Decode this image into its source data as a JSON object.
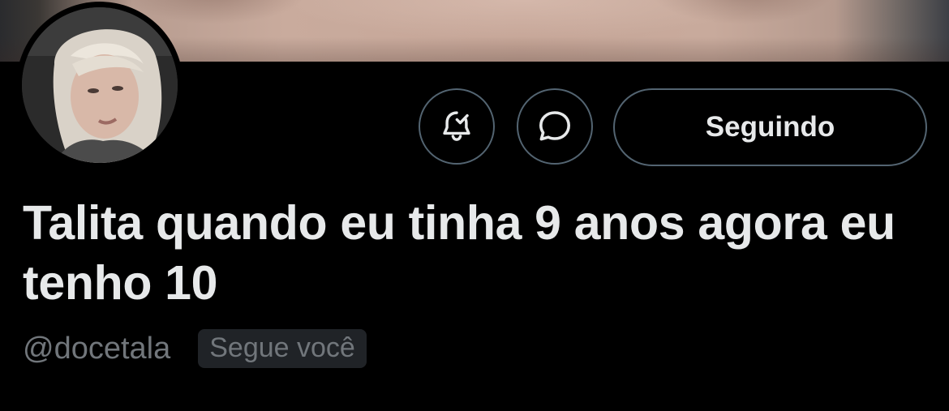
{
  "profile": {
    "display_name": "Talita quando eu tinha 9 anos agora eu tenho 10",
    "handle": "@docetala",
    "follows_you_badge": "Segue você"
  },
  "actions": {
    "notifications_icon": "bell-check-icon",
    "message_icon": "chat-bubble-icon",
    "follow_label": "Seguindo"
  },
  "theme": {
    "background": "#000000",
    "text_primary": "#e7e9ea",
    "text_secondary": "#71767b",
    "border": "#536471",
    "badge_bg": "#202327"
  }
}
